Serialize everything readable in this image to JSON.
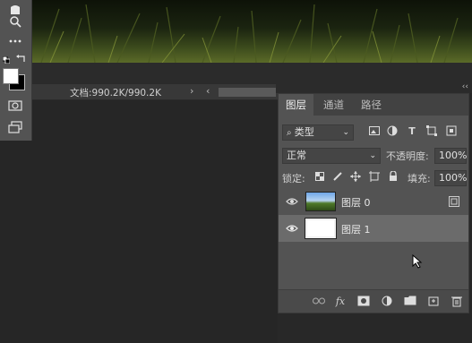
{
  "status_bar": {
    "doc_info": "文档:990.2K/990.2K",
    "nav_right": "›",
    "nav_left": "‹"
  },
  "toolbar": {
    "tools": [
      "hand-icon",
      "zoom-icon",
      "more-icon",
      "default-colors-icon",
      "swap-colors-icon",
      "foreground-color",
      "background-color",
      "quick-mask-icon",
      "screen-mode-icon"
    ]
  },
  "layers_panel": {
    "tabs": [
      "图层",
      "通道",
      "路径"
    ],
    "active_tab": "图层",
    "filter_kind": "类型",
    "blend_mode": "正常",
    "opacity_label": "不透明度:",
    "opacity_value": "100%",
    "lock_label": "锁定:",
    "fill_label": "填充:",
    "fill_value": "100%",
    "layers": [
      {
        "name": "图层 0",
        "thumb": "photo",
        "selected": false
      },
      {
        "name": "图层 1",
        "thumb": "white",
        "selected": true
      }
    ],
    "collapse_glyph": "‹‹"
  },
  "colors": {
    "panel_bg": "#535353",
    "selected_layer": "#6b6b6b",
    "app_bg": "#232323"
  }
}
